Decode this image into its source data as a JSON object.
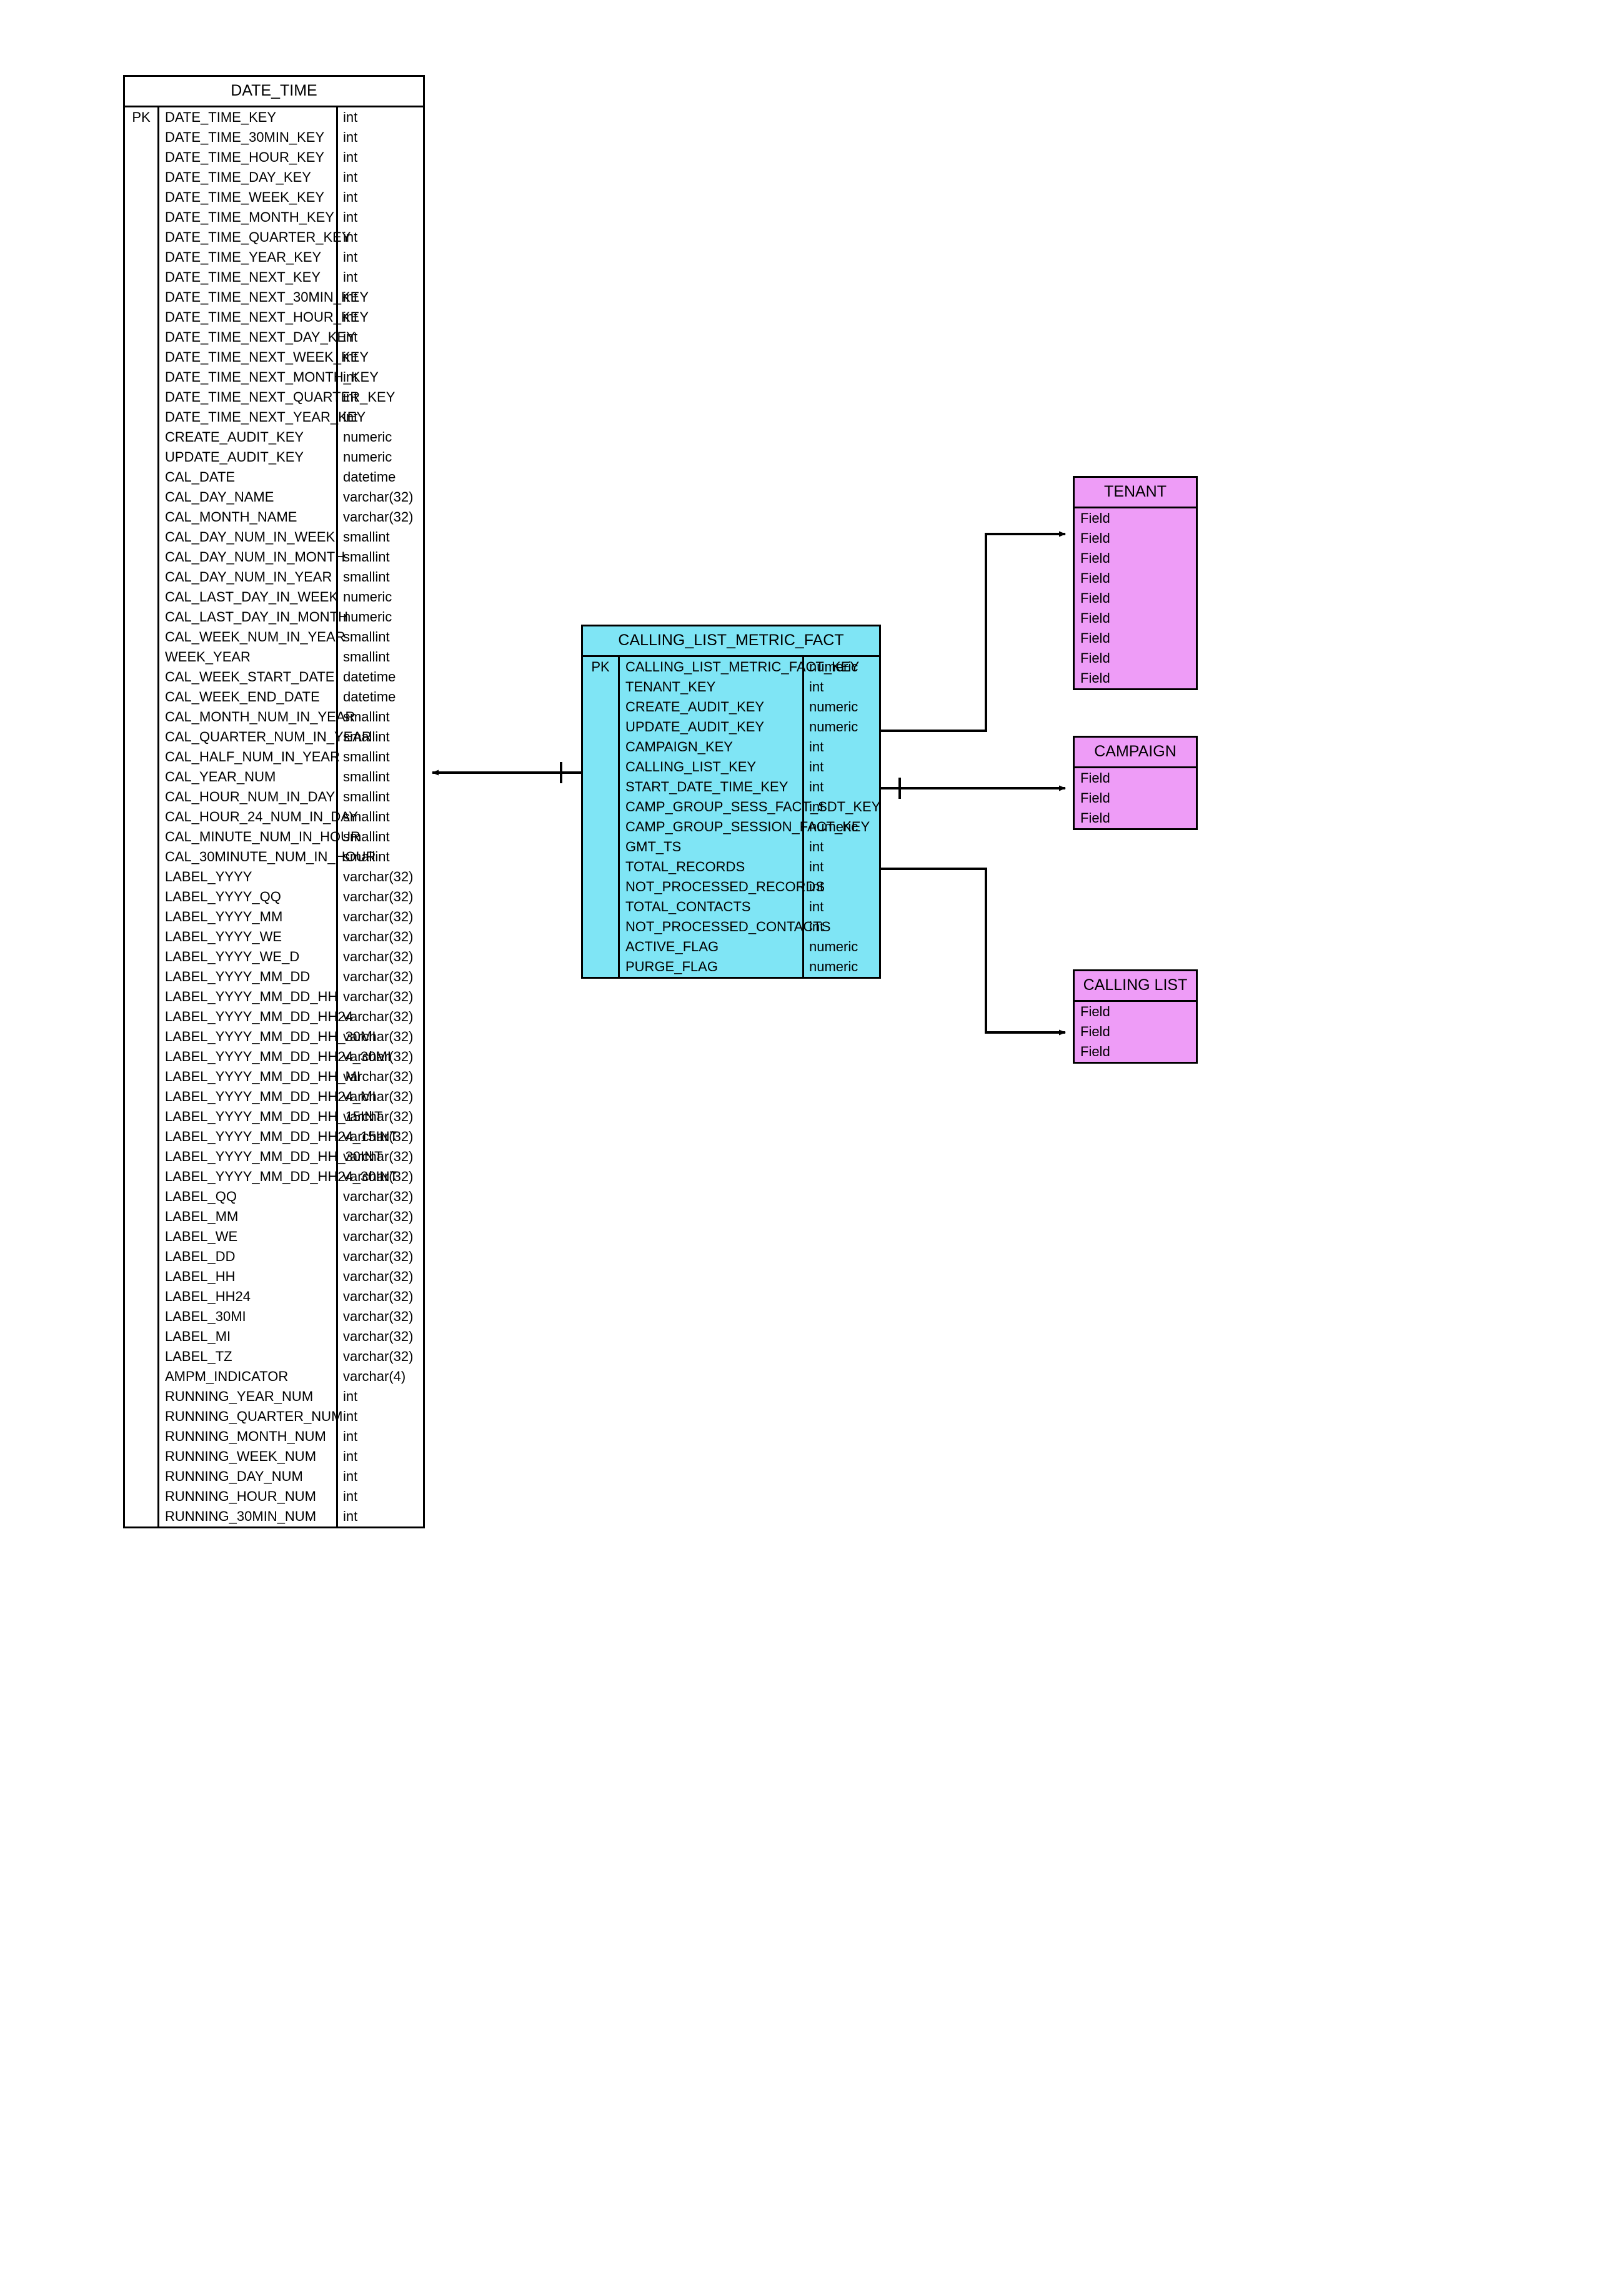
{
  "diagram": {
    "type": "entity-relationship-diagram",
    "colors": {
      "fact_fill": "#7FE5F5",
      "dimension_fill": "#EE9CF7",
      "date_time_fill": "#FFFFFF",
      "border": "#000000",
      "connector": "#000000"
    }
  },
  "entities": {
    "date_time": {
      "title": "DATE_TIME",
      "fill": "#FFFFFF",
      "pk_label": "PK",
      "columns": [
        {
          "pk": "PK",
          "name": "DATE_TIME_KEY",
          "type": "int"
        },
        {
          "pk": "",
          "name": "DATE_TIME_30MIN_KEY",
          "type": "int"
        },
        {
          "pk": "",
          "name": "DATE_TIME_HOUR_KEY",
          "type": "int"
        },
        {
          "pk": "",
          "name": "DATE_TIME_DAY_KEY",
          "type": "int"
        },
        {
          "pk": "",
          "name": "DATE_TIME_WEEK_KEY",
          "type": "int"
        },
        {
          "pk": "",
          "name": "DATE_TIME_MONTH_KEY",
          "type": "int"
        },
        {
          "pk": "",
          "name": "DATE_TIME_QUARTER_KEY",
          "type": "int"
        },
        {
          "pk": "",
          "name": "DATE_TIME_YEAR_KEY",
          "type": "int"
        },
        {
          "pk": "",
          "name": "DATE_TIME_NEXT_KEY",
          "type": "int"
        },
        {
          "pk": "",
          "name": "DATE_TIME_NEXT_30MIN_KEY",
          "type": "int"
        },
        {
          "pk": "",
          "name": "DATE_TIME_NEXT_HOUR_KEY",
          "type": "int"
        },
        {
          "pk": "",
          "name": "DATE_TIME_NEXT_DAY_KEY",
          "type": "int"
        },
        {
          "pk": "",
          "name": "DATE_TIME_NEXT_WEEK_KEY",
          "type": "int"
        },
        {
          "pk": "",
          "name": "DATE_TIME_NEXT_MONTH_KEY",
          "type": "int"
        },
        {
          "pk": "",
          "name": "DATE_TIME_NEXT_QUARTER_KEY",
          "type": "int"
        },
        {
          "pk": "",
          "name": "DATE_TIME_NEXT_YEAR_KEY",
          "type": "int"
        },
        {
          "pk": "",
          "name": "CREATE_AUDIT_KEY",
          "type": "numeric"
        },
        {
          "pk": "",
          "name": "UPDATE_AUDIT_KEY",
          "type": "numeric"
        },
        {
          "pk": "",
          "name": "CAL_DATE",
          "type": "datetime"
        },
        {
          "pk": "",
          "name": "CAL_DAY_NAME",
          "type": "varchar(32)"
        },
        {
          "pk": "",
          "name": "CAL_MONTH_NAME",
          "type": "varchar(32)"
        },
        {
          "pk": "",
          "name": "CAL_DAY_NUM_IN_WEEK",
          "type": "smallint"
        },
        {
          "pk": "",
          "name": "CAL_DAY_NUM_IN_MONTH",
          "type": "smallint"
        },
        {
          "pk": "",
          "name": "CAL_DAY_NUM_IN_YEAR",
          "type": "smallint"
        },
        {
          "pk": "",
          "name": "CAL_LAST_DAY_IN_WEEK",
          "type": "numeric"
        },
        {
          "pk": "",
          "name": "CAL_LAST_DAY_IN_MONTH",
          "type": "numeric"
        },
        {
          "pk": "",
          "name": "CAL_WEEK_NUM_IN_YEAR",
          "type": "smallint"
        },
        {
          "pk": "",
          "name": "WEEK_YEAR",
          "type": "smallint"
        },
        {
          "pk": "",
          "name": "CAL_WEEK_START_DATE",
          "type": "datetime"
        },
        {
          "pk": "",
          "name": "CAL_WEEK_END_DATE",
          "type": "datetime"
        },
        {
          "pk": "",
          "name": "CAL_MONTH_NUM_IN_YEAR",
          "type": "smallint"
        },
        {
          "pk": "",
          "name": "CAL_QUARTER_NUM_IN_YEAR",
          "type": "smallint"
        },
        {
          "pk": "",
          "name": "CAL_HALF_NUM_IN_YEAR",
          "type": "smallint"
        },
        {
          "pk": "",
          "name": "CAL_YEAR_NUM",
          "type": "smallint"
        },
        {
          "pk": "",
          "name": "CAL_HOUR_NUM_IN_DAY",
          "type": "smallint"
        },
        {
          "pk": "",
          "name": "CAL_HOUR_24_NUM_IN_DAY",
          "type": "smallint"
        },
        {
          "pk": "",
          "name": "CAL_MINUTE_NUM_IN_HOUR",
          "type": "smallint"
        },
        {
          "pk": "",
          "name": "CAL_30MINUTE_NUM_IN_HOUR",
          "type": "smallint"
        },
        {
          "pk": "",
          "name": "LABEL_YYYY",
          "type": "varchar(32)"
        },
        {
          "pk": "",
          "name": "LABEL_YYYY_QQ",
          "type": "varchar(32)"
        },
        {
          "pk": "",
          "name": "LABEL_YYYY_MM",
          "type": "varchar(32)"
        },
        {
          "pk": "",
          "name": "LABEL_YYYY_WE",
          "type": "varchar(32)"
        },
        {
          "pk": "",
          "name": "LABEL_YYYY_WE_D",
          "type": "varchar(32)"
        },
        {
          "pk": "",
          "name": "LABEL_YYYY_MM_DD",
          "type": "varchar(32)"
        },
        {
          "pk": "",
          "name": "LABEL_YYYY_MM_DD_HH",
          "type": "varchar(32)"
        },
        {
          "pk": "",
          "name": "LABEL_YYYY_MM_DD_HH24",
          "type": "varchar(32)"
        },
        {
          "pk": "",
          "name": "LABEL_YYYY_MM_DD_HH_30MI",
          "type": "varchar(32)"
        },
        {
          "pk": "",
          "name": "LABEL_YYYY_MM_DD_HH24_30MI",
          "type": "varchar(32)"
        },
        {
          "pk": "",
          "name": "LABEL_YYYY_MM_DD_HH_MI",
          "type": "varchar(32)"
        },
        {
          "pk": "",
          "name": "LABEL_YYYY_MM_DD_HH24_MI",
          "type": "varchar(32)"
        },
        {
          "pk": "",
          "name": "LABEL_YYYY_MM_DD_HH_15INT",
          "type": "varchar(32)"
        },
        {
          "pk": "",
          "name": "LABEL_YYYY_MM_DD_HH24_15INT",
          "type": "varchar(32)"
        },
        {
          "pk": "",
          "name": "LABEL_YYYY_MM_DD_HH_30INT",
          "type": "varchar(32)"
        },
        {
          "pk": "",
          "name": "LABEL_YYYY_MM_DD_HH24_30INT",
          "type": "varchar(32)"
        },
        {
          "pk": "",
          "name": "LABEL_QQ",
          "type": "varchar(32)"
        },
        {
          "pk": "",
          "name": "LABEL_MM",
          "type": "varchar(32)"
        },
        {
          "pk": "",
          "name": "LABEL_WE",
          "type": "varchar(32)"
        },
        {
          "pk": "",
          "name": "LABEL_DD",
          "type": "varchar(32)"
        },
        {
          "pk": "",
          "name": "LABEL_HH",
          "type": "varchar(32)"
        },
        {
          "pk": "",
          "name": "LABEL_HH24",
          "type": "varchar(32)"
        },
        {
          "pk": "",
          "name": "LABEL_30MI",
          "type": "varchar(32)"
        },
        {
          "pk": "",
          "name": "LABEL_MI",
          "type": "varchar(32)"
        },
        {
          "pk": "",
          "name": "LABEL_TZ",
          "type": "varchar(32)"
        },
        {
          "pk": "",
          "name": "AMPM_INDICATOR",
          "type": "varchar(4)"
        },
        {
          "pk": "",
          "name": "RUNNING_YEAR_NUM",
          "type": "int"
        },
        {
          "pk": "",
          "name": "RUNNING_QUARTER_NUM",
          "type": "int"
        },
        {
          "pk": "",
          "name": "RUNNING_MONTH_NUM",
          "type": "int"
        },
        {
          "pk": "",
          "name": "RUNNING_WEEK_NUM",
          "type": "int"
        },
        {
          "pk": "",
          "name": "RUNNING_DAY_NUM",
          "type": "int"
        },
        {
          "pk": "",
          "name": "RUNNING_HOUR_NUM",
          "type": "int"
        },
        {
          "pk": "",
          "name": "RUNNING_30MIN_NUM",
          "type": "int"
        }
      ]
    },
    "calling_list_metric_fact": {
      "title": "CALLING_LIST_METRIC_FACT",
      "fill": "#7FE5F5",
      "pk_label": "PK",
      "columns": [
        {
          "pk": "PK",
          "name": "CALLING_LIST_METRIC_FACT_KEY",
          "type": "numeric"
        },
        {
          "pk": "",
          "name": "TENANT_KEY",
          "type": "int"
        },
        {
          "pk": "",
          "name": "CREATE_AUDIT_KEY",
          "type": "numeric"
        },
        {
          "pk": "",
          "name": "UPDATE_AUDIT_KEY",
          "type": "numeric"
        },
        {
          "pk": "",
          "name": "CAMPAIGN_KEY",
          "type": "int"
        },
        {
          "pk": "",
          "name": "CALLING_LIST_KEY",
          "type": "int"
        },
        {
          "pk": "",
          "name": "START_DATE_TIME_KEY",
          "type": "int"
        },
        {
          "pk": "",
          "name": "CAMP_GROUP_SESS_FACT_SDT_KEY",
          "type": "int"
        },
        {
          "pk": "",
          "name": "CAMP_GROUP_SESSION_FACT_KEY",
          "type": "numeric"
        },
        {
          "pk": "",
          "name": "GMT_TS",
          "type": "int"
        },
        {
          "pk": "",
          "name": "TOTAL_RECORDS",
          "type": "int"
        },
        {
          "pk": "",
          "name": "NOT_PROCESSED_RECORDS",
          "type": "int"
        },
        {
          "pk": "",
          "name": "TOTAL_CONTACTS",
          "type": "int"
        },
        {
          "pk": "",
          "name": "NOT_PROCESSED_CONTACTS",
          "type": "int"
        },
        {
          "pk": "",
          "name": "ACTIVE_FLAG",
          "type": "numeric"
        },
        {
          "pk": "",
          "name": "PURGE_FLAG",
          "type": "numeric"
        }
      ]
    },
    "tenant": {
      "title": "TENANT",
      "fill": "#EE9CF7",
      "columns": [
        {
          "name": "Field"
        },
        {
          "name": "Field"
        },
        {
          "name": "Field"
        },
        {
          "name": "Field"
        },
        {
          "name": "Field"
        },
        {
          "name": "Field"
        },
        {
          "name": "Field"
        },
        {
          "name": "Field"
        },
        {
          "name": "Field"
        }
      ]
    },
    "campaign": {
      "title": "CAMPAIGN",
      "fill": "#EE9CF7",
      "columns": [
        {
          "name": "Field"
        },
        {
          "name": "Field"
        },
        {
          "name": "Field"
        }
      ]
    },
    "calling_list": {
      "title": "CALLING LIST",
      "fill": "#EE9CF7",
      "columns": [
        {
          "name": "Field"
        },
        {
          "name": "Field"
        },
        {
          "name": "Field"
        }
      ]
    }
  },
  "relationships": [
    {
      "from": "calling_list_metric_fact",
      "to": "date_time",
      "name": "fact-to-date-time"
    },
    {
      "from": "calling_list_metric_fact",
      "to": "tenant",
      "name": "fact-to-tenant"
    },
    {
      "from": "calling_list_metric_fact",
      "to": "campaign",
      "name": "fact-to-campaign"
    },
    {
      "from": "calling_list_metric_fact",
      "to": "calling_list",
      "name": "fact-to-calling-list"
    }
  ]
}
